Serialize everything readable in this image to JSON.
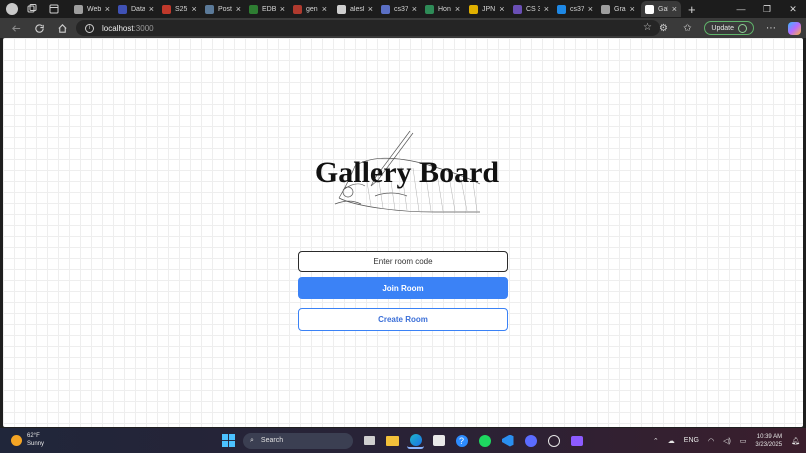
{
  "browser": {
    "tabs": [
      {
        "label": "Web",
        "color": "#9e9e9e"
      },
      {
        "label": "Data",
        "color": "#3f51b5"
      },
      {
        "label": "S25",
        "color": "#c0392b"
      },
      {
        "label": "Post",
        "color": "#5b7a99"
      },
      {
        "label": "EDB",
        "color": "#2e7d32"
      },
      {
        "label": "gen",
        "color": "#b03a2e"
      },
      {
        "label": "alesl",
        "color": "#cfcfcf"
      },
      {
        "label": "cs37",
        "color": "#5a6fc4"
      },
      {
        "label": "Hon",
        "color": "#2e8b57"
      },
      {
        "label": "JPN",
        "color": "#e0b000"
      },
      {
        "label": "CS 3",
        "color": "#6a4fb5"
      },
      {
        "label": "cs37",
        "color": "#1e88e5"
      },
      {
        "label": "Gra",
        "color": "#9e9e9e"
      },
      {
        "label": "Gall",
        "color": "#ffffff"
      }
    ],
    "new_tab": "+",
    "window_controls": {
      "minimize": "—",
      "restore": "❐",
      "close": "✕"
    },
    "url_host": "localhost",
    "url_port": ":3000",
    "update_label": "Update"
  },
  "page": {
    "logo_text": "Gallery Board",
    "room_code_placeholder": "Enter room code",
    "join_button": "Join Room",
    "create_button": "Create Room"
  },
  "taskbar": {
    "temperature": "62°F",
    "condition": "Sunny",
    "search_label": "Search",
    "language": "ENG",
    "time": "10:39 AM",
    "date": "3/23/2025"
  }
}
